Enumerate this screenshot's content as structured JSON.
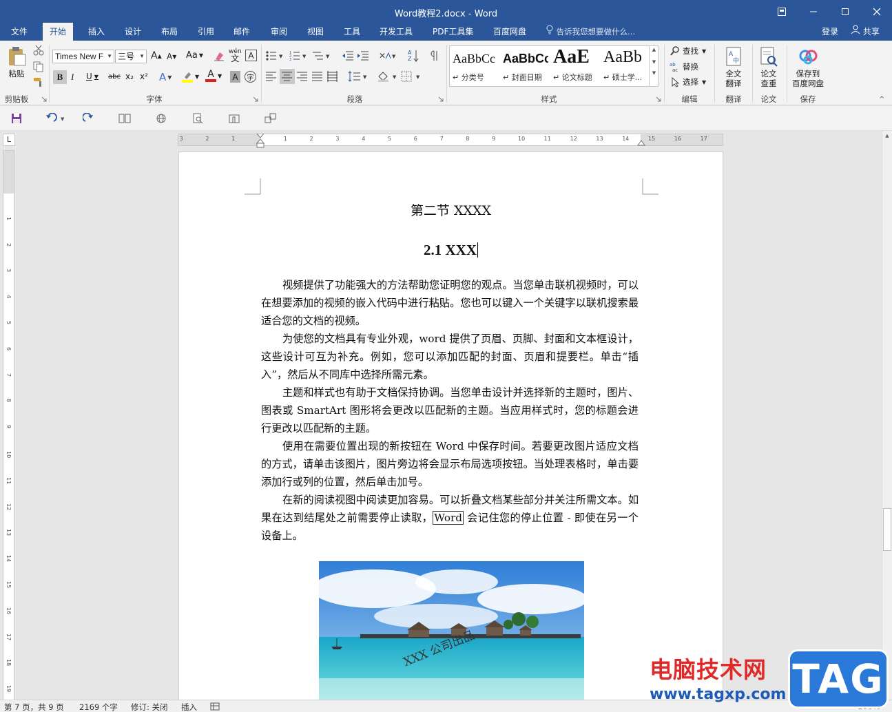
{
  "window": {
    "title": "Word教程2.docx - Word",
    "controls": [
      "ribbon-display-icon",
      "minimize-icon",
      "maximize-icon",
      "close-icon"
    ]
  },
  "tabs": [
    {
      "label": "文件",
      "active": false
    },
    {
      "label": "开始",
      "active": true
    },
    {
      "label": "插入",
      "active": false
    },
    {
      "label": "设计",
      "active": false
    },
    {
      "label": "布局",
      "active": false
    },
    {
      "label": "引用",
      "active": false
    },
    {
      "label": "邮件",
      "active": false
    },
    {
      "label": "审阅",
      "active": false
    },
    {
      "label": "视图",
      "active": false
    },
    {
      "label": "工具",
      "active": false
    },
    {
      "label": "开发工具",
      "active": false
    },
    {
      "label": "PDF工具集",
      "active": false
    },
    {
      "label": "百度网盘",
      "active": false
    }
  ],
  "tell_me": "告诉我您想要做什么...",
  "account": {
    "login": "登录",
    "share": "共享"
  },
  "ribbon": {
    "clipboard": {
      "paste": "粘贴",
      "label": "剪贴板"
    },
    "font": {
      "font_name": "Times New F",
      "font_size": "三号",
      "change_case": "Aa",
      "pinyin": "wén",
      "label": "字体",
      "bold": "B",
      "italic": "I",
      "underline": "U",
      "strike": "abc",
      "subscript": "x₂",
      "superscript": "x²",
      "grow": "A",
      "shrink": "A",
      "char_border": "A",
      "char_shade": "A",
      "enclose": "字"
    },
    "paragraph": {
      "label": "段落"
    },
    "styles": {
      "label": "样式",
      "items": [
        {
          "sample": "AaBbCc",
          "name": "↵ 分类号"
        },
        {
          "sample": "AaBbCc",
          "name": "↵ 封面日期"
        },
        {
          "sample": "AaE",
          "name": "↵ 论文标题"
        },
        {
          "sample": "AaBb",
          "name": "↵ 硕士学..."
        }
      ]
    },
    "editing": {
      "find": "查找",
      "replace": "替换",
      "select": "选择",
      "label": "编辑"
    },
    "translate": {
      "button": "全文\n翻译",
      "line1": "全文",
      "line2": "翻译",
      "label": "翻译"
    },
    "paper": {
      "line1": "论文",
      "line2": "查重",
      "label": "论文"
    },
    "save": {
      "line1": "保存到",
      "line2": "百度网盘",
      "label": "保存"
    }
  },
  "ruler": {
    "h_ticks": [
      "3",
      "2",
      "1",
      "1",
      "2",
      "3",
      "4",
      "5",
      "6",
      "7",
      "8",
      "9",
      "10",
      "11",
      "12",
      "13",
      "14",
      "15",
      "16",
      "17"
    ],
    "v_ticks": [
      "1",
      "2",
      "3",
      "4",
      "5",
      "6",
      "7",
      "8",
      "9",
      "10",
      "11",
      "12",
      "13",
      "14",
      "15",
      "16",
      "17",
      "18",
      "19"
    ],
    "tab_stop": "L"
  },
  "document": {
    "heading1": "第二节  XXXX",
    "heading2": "2.1 XXX",
    "paragraphs": [
      "视频提供了功能强大的方法帮助您证明您的观点。当您单击联机视频时，可以在想要添加的视频的嵌入代码中进行粘贴。您也可以键入一个关键字以联机搜索最适合您的文档的视频。",
      "为使您的文档具有专业外观，word 提供了页眉、页脚、封面和文本框设计，这些设计可互为补充。例如，您可以添加匹配的封面、页眉和提要栏。单击“插入”，然后从不同库中选择所需元素。",
      "主题和样式也有助于文档保持协调。当您单击设计并选择新的主题时，图片、图表或 SmartArt 图形将会更改以匹配新的主题。当应用样式时，您的标题会进行更改以匹配新的主题。",
      "使用在需要位置出现的新按钮在 Word 中保存时间。若要更改图片适应文档的方式，请单击该图片，图片旁边将会显示布局选项按钮。当处理表格时，单击要添加行或列的位置，然后单击加号。"
    ],
    "last_paragraph": {
      "before": "在新的阅读视图中阅读更加容易。可以折叠文档某些部分并关注所需文本。如果在达到结尾处之前需要停止读取，",
      "boxed": "Word",
      "after": " 会记住您的停止位置 - 即使在另一个设备上。"
    },
    "image_watermark": "XXX 公司出品"
  },
  "status": {
    "page": "第 7 页，共 9 页",
    "words": "2169 个字",
    "track": "修订: 关闭",
    "mode": "插入",
    "zoom": "100%"
  },
  "overlay": {
    "site_name": "电脑技术网",
    "url": "www.tagxp.com",
    "tag": "TAG"
  },
  "colors": {
    "brand": "#2b579a",
    "ribbon_bg": "#f3f3f3",
    "overlay_red": "#e02a2a",
    "overlay_blue": "#2a79d8"
  }
}
